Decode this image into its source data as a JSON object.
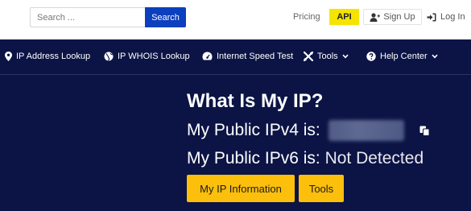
{
  "topbar": {
    "search_placeholder": "Search ...",
    "search_button": "Search",
    "pricing": "Pricing",
    "api": "API",
    "signup": "Sign Up",
    "login": "Log In"
  },
  "nav": {
    "items": [
      {
        "label": "IP Address Lookup",
        "icon": "map-marker-icon"
      },
      {
        "label": "IP WHOIS Lookup",
        "icon": "globe-icon"
      },
      {
        "label": "Internet Speed Test",
        "icon": "speedometer-icon"
      },
      {
        "label": "Tools",
        "icon": "tools-icon"
      },
      {
        "label": "Help Center",
        "icon": "question-circle-icon"
      }
    ]
  },
  "hero": {
    "title": "What Is My IP?",
    "ipv4_label": "My Public IPv4 is:",
    "ipv6_label": "My Public IPv6 is:",
    "ipv6_value": "Not Detected",
    "btn_ip_info": "My IP Information",
    "btn_tools": "Tools"
  },
  "colors": {
    "navy": "#0b1445",
    "search_blue": "#0b3fbd",
    "api_yellow": "#f5e400",
    "button_yellow": "#fbbf0c"
  }
}
